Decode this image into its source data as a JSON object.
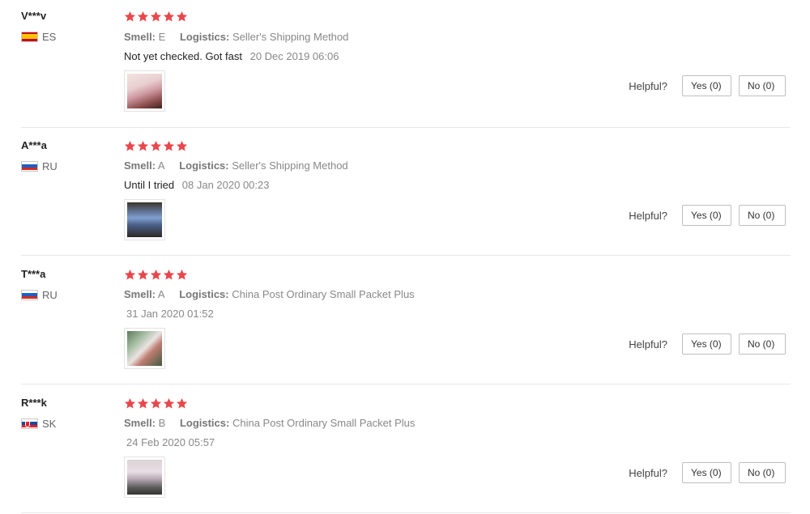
{
  "reviews": [
    {
      "user": "V***v",
      "country": "ES",
      "rating": 5,
      "smell_label": "Smell:",
      "smell_value": "E",
      "logistics_label": "Logistics:",
      "logistics_value": "Seller's Shipping Method",
      "comment": "Not yet checked. Got fast",
      "date": "20 Dec 2019 06:06",
      "helpful_label": "Helpful?",
      "yes_label": "Yes (0)",
      "no_label": "No (0)"
    },
    {
      "user": "A***a",
      "country": "RU",
      "rating": 5,
      "smell_label": "Smell:",
      "smell_value": "A",
      "logistics_label": "Logistics:",
      "logistics_value": "Seller's Shipping Method",
      "comment": "Until I tried",
      "date": "08 Jan 2020 00:23",
      "helpful_label": "Helpful?",
      "yes_label": "Yes (0)",
      "no_label": "No (0)"
    },
    {
      "user": "T***a",
      "country": "RU",
      "rating": 5,
      "smell_label": "Smell:",
      "smell_value": "A",
      "logistics_label": "Logistics:",
      "logistics_value": "China Post Ordinary Small Packet Plus",
      "comment": "",
      "date": "31 Jan 2020 01:52",
      "helpful_label": "Helpful?",
      "yes_label": "Yes (0)",
      "no_label": "No (0)"
    },
    {
      "user": "R***k",
      "country": "SK",
      "rating": 5,
      "smell_label": "Smell:",
      "smell_value": "B",
      "logistics_label": "Logistics:",
      "logistics_value": "China Post Ordinary Small Packet Plus",
      "comment": "",
      "date": "24 Feb 2020 05:57",
      "helpful_label": "Helpful?",
      "yes_label": "Yes (0)",
      "no_label": "No (0)"
    }
  ],
  "colors": {
    "star": "#e8474c",
    "divider": "#e8e8e8"
  },
  "icons": {
    "star": "star-icon",
    "flag_es": "flag-es-icon",
    "flag_ru": "flag-ru-icon",
    "flag_sk": "flag-sk-icon"
  }
}
